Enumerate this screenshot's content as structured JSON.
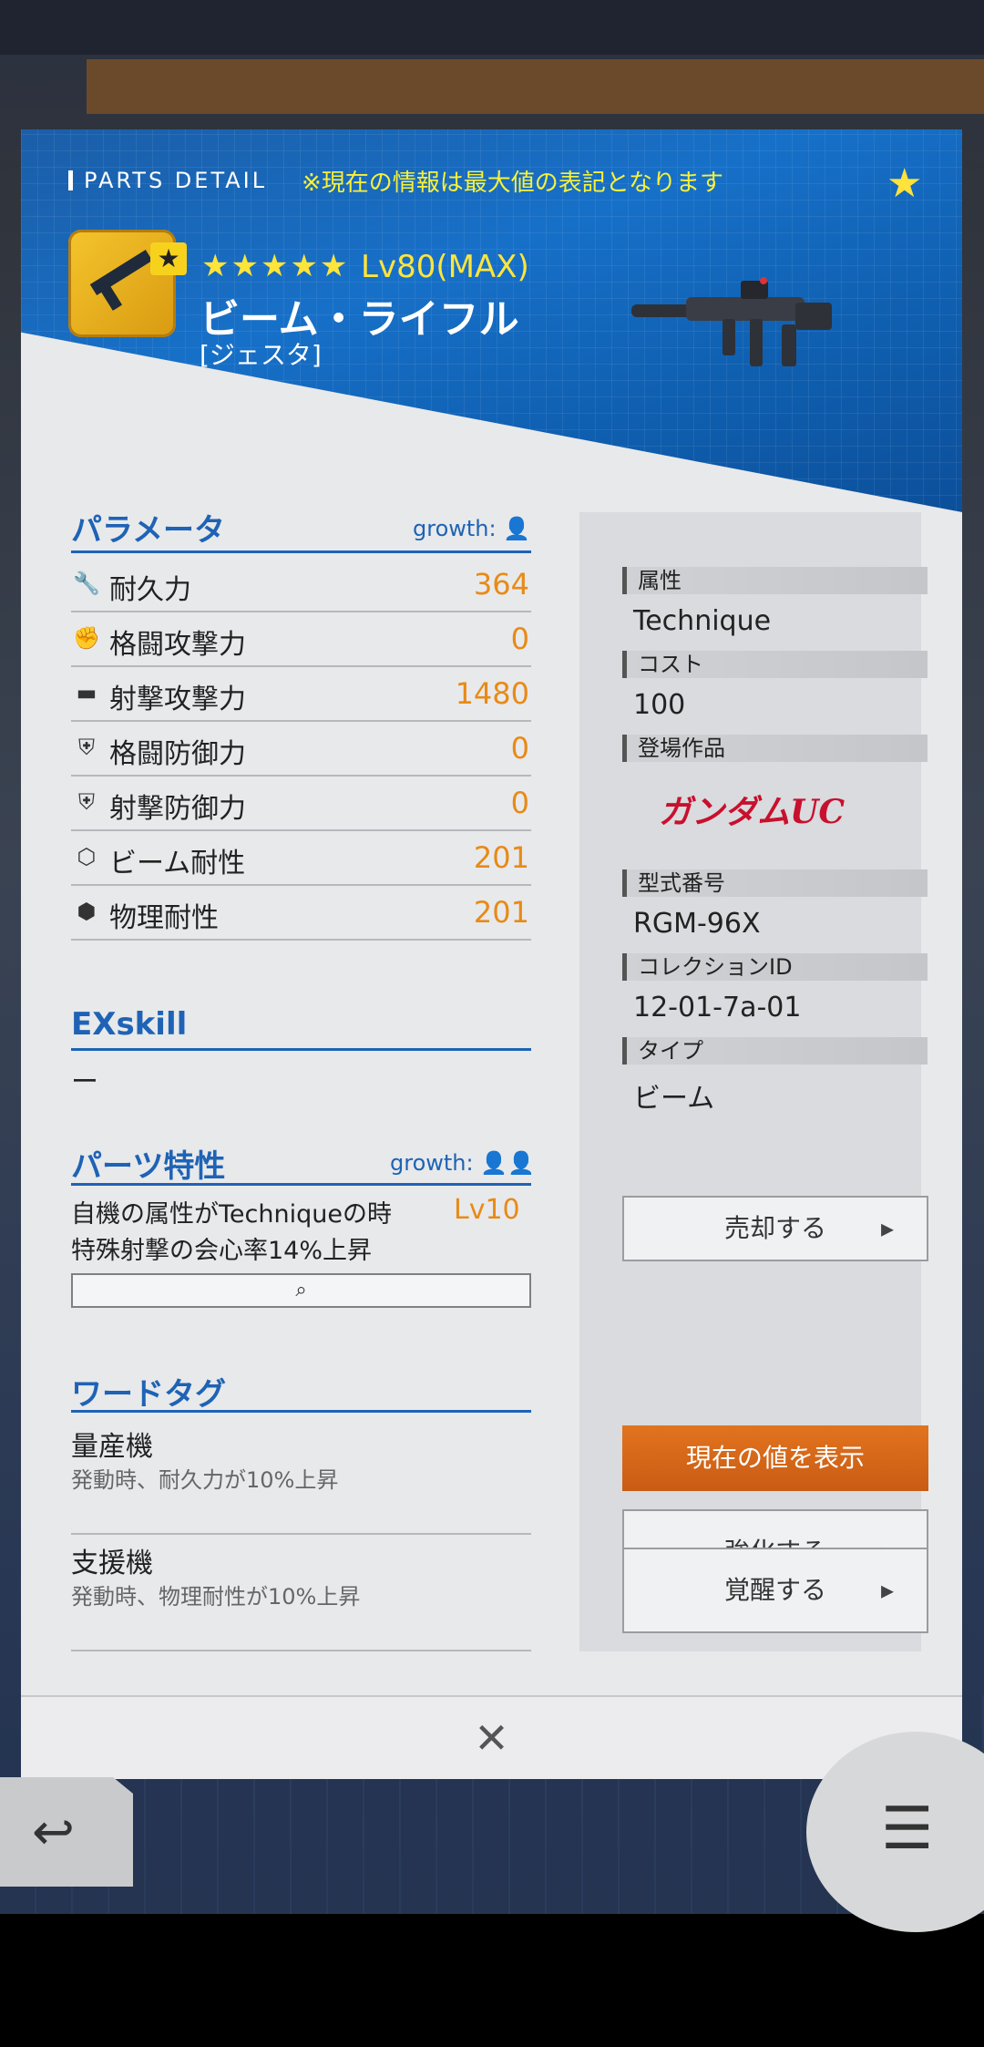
{
  "header": {
    "tag": "PARTS DETAIL",
    "note": "※現在の情報は最大値の表記となります",
    "rarity": "★★★★★",
    "level": "Lv80(MAX)",
    "part_name": "ビーム・ライフル",
    "part_sub": "[ジェスタ]"
  },
  "params": {
    "title": "パラメータ",
    "growth": "growth:",
    "rows": [
      {
        "label": "耐久力",
        "value": "364",
        "icon": "wrench-icon"
      },
      {
        "label": "格闘攻撃力",
        "value": "0",
        "icon": "melee-icon"
      },
      {
        "label": "射撃攻撃力",
        "value": "1480",
        "icon": "gun-icon"
      },
      {
        "label": "格闘防御力",
        "value": "0",
        "icon": "shield-melee-icon"
      },
      {
        "label": "射撃防御力",
        "value": "0",
        "icon": "shield-shot-icon"
      },
      {
        "label": "ビーム耐性",
        "value": "201",
        "icon": "hex-beam-icon"
      },
      {
        "label": "物理耐性",
        "value": "201",
        "icon": "hex-physical-icon"
      }
    ]
  },
  "exskill": {
    "title": "EXskill",
    "value": "ー"
  },
  "traits": {
    "title": "パーツ特性",
    "growth": "growth:",
    "text_line1": "自機の属性がTechniqueの時",
    "text_line2": "特殊射撃の会心率14%上昇",
    "level": "Lv10"
  },
  "wordtags": {
    "title": "ワードタグ",
    "items": [
      {
        "name": "量産機",
        "desc": "発動時、耐久力が10%上昇"
      },
      {
        "name": "支援機",
        "desc": "発動時、物理耐性が10%上昇"
      }
    ]
  },
  "info": {
    "attr_label": "属性",
    "attr_value": "Technique",
    "cost_label": "コスト",
    "cost_value": "100",
    "series_label": "登場作品",
    "series_logo": "ガンダムUC",
    "model_label": "型式番号",
    "model_value": "RGM-96X",
    "collection_label": "コレクションID",
    "collection_value": "12-01-7a-01",
    "type_label": "タイプ",
    "type_value": "ビーム"
  },
  "buttons": {
    "sell": "売却する",
    "show_current": "現在の値を表示",
    "enhance": "強化する",
    "awaken": "覚醒する"
  },
  "colors": {
    "accent": "#1e63b5",
    "value": "#e88a16",
    "orange_btn": "#d8661a",
    "header_blue": "#1770c8"
  }
}
